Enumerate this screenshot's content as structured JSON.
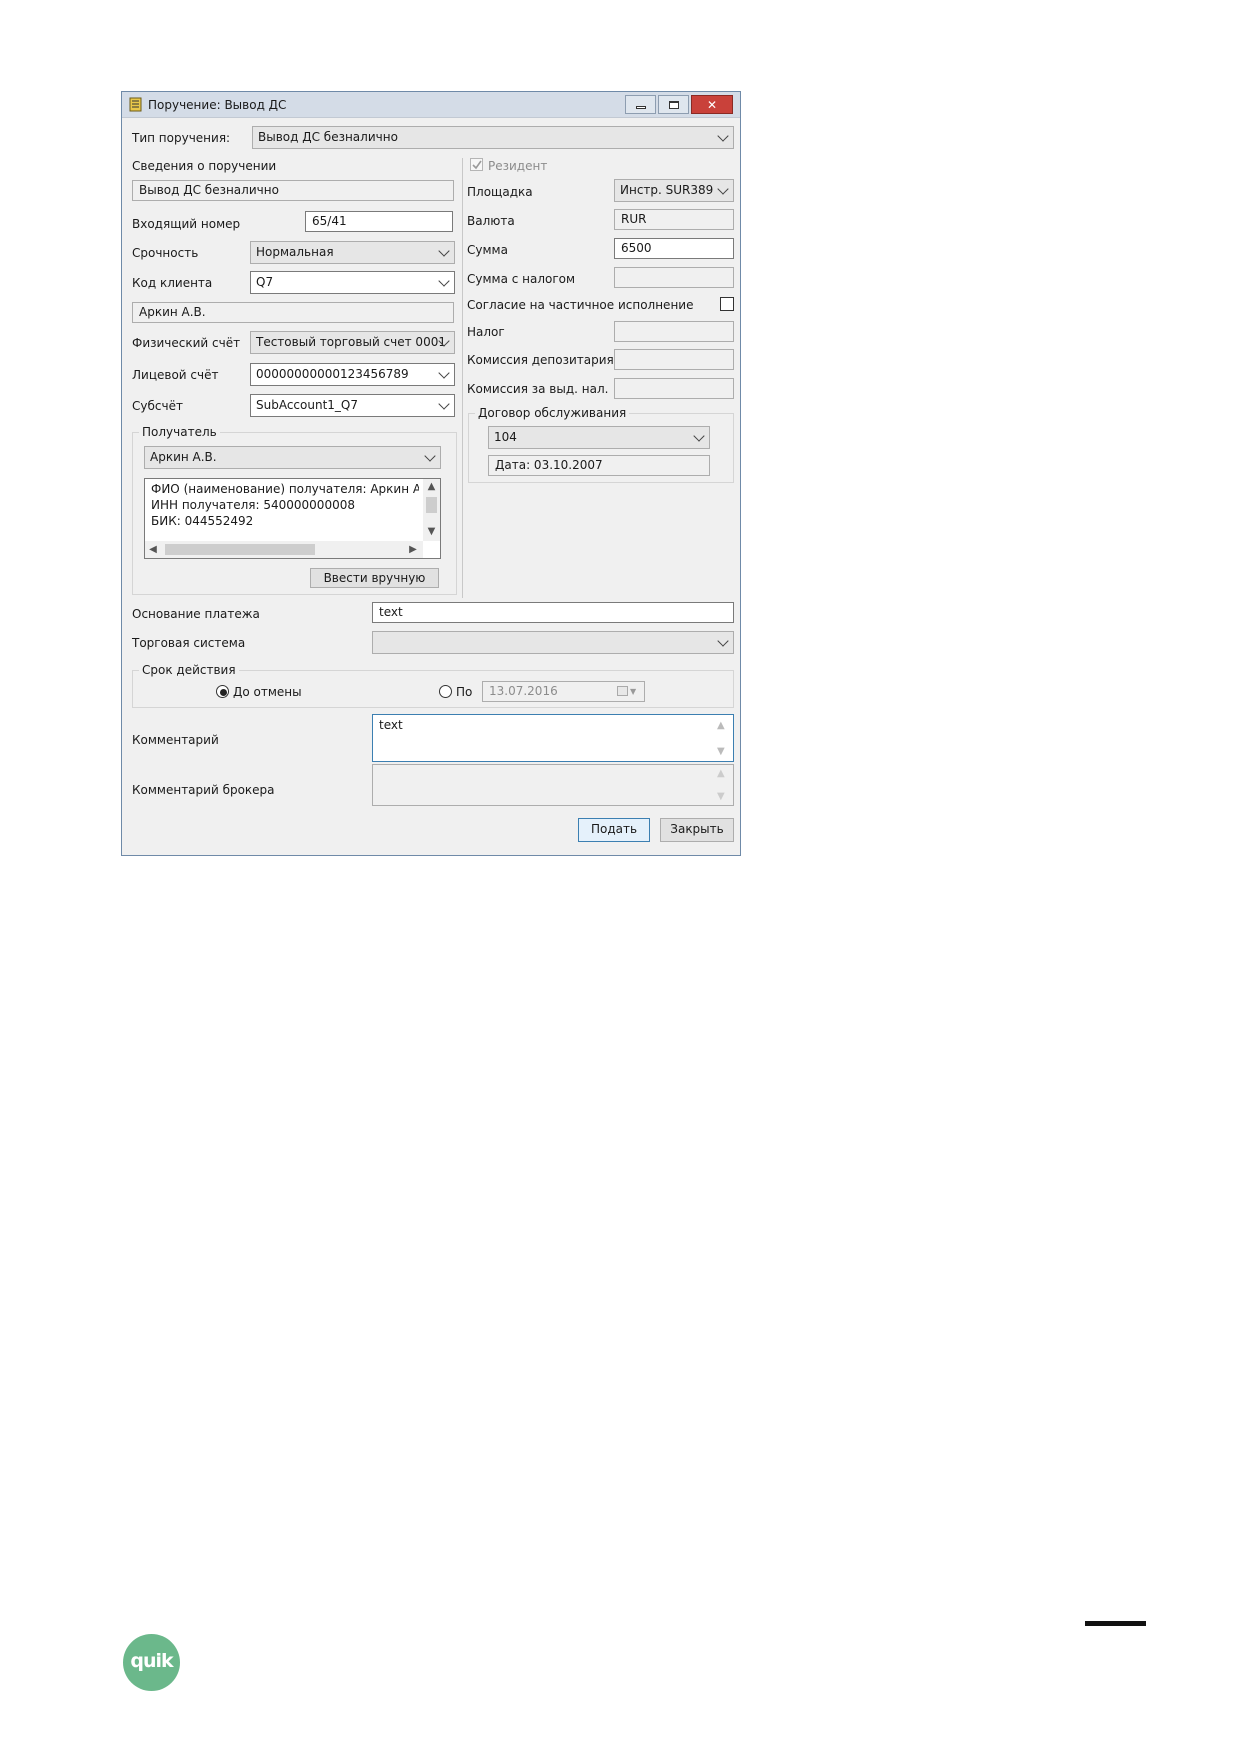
{
  "window": {
    "title": "Поручение: Вывод ДС",
    "minimize_glyph": "▭",
    "maximize_glyph": "▢",
    "close_glyph": "✕"
  },
  "order_type": {
    "label": "Тип поручения:",
    "value": "Вывод ДС безналично"
  },
  "order_info": {
    "label": "Сведения о поручении",
    "value": "Вывод ДС безналично"
  },
  "incoming_number": {
    "label": "Входящий номер",
    "value": "65/41"
  },
  "urgency": {
    "label": "Срочность",
    "value": "Нормальная"
  },
  "client_code": {
    "label": "Код клиента",
    "value": "Q7"
  },
  "client_name": "Аркин А.В.",
  "physical_account": {
    "label": "Физический счёт",
    "value": "Тестовый торговый счет 0001"
  },
  "personal_account": {
    "label": "Лицевой счёт",
    "value": "00000000000123456789"
  },
  "subaccount": {
    "label": "Субсчёт",
    "value": "SubAccount1_Q7"
  },
  "recipient": {
    "legend": "Получатель",
    "selected": "Аркин А.В.",
    "details": [
      "ФИО (наименование) получателя: Аркин Ар",
      "ИНН получателя: 540000000008",
      "БИК: 044552492"
    ],
    "manual_button": "Ввести вручную"
  },
  "resident": {
    "label": "Резидент",
    "checked": true
  },
  "platform": {
    "label": "Площадка",
    "value": "Инстр. SUR389"
  },
  "currency": {
    "label": "Валюта",
    "value": "RUR"
  },
  "amount": {
    "label": "Сумма",
    "value": "6500"
  },
  "amount_with_tax": {
    "label": "Сумма с налогом",
    "value": ""
  },
  "partial_execution": {
    "label": "Согласие на частичное исполнение",
    "checked": false
  },
  "tax": {
    "label": "Налог",
    "value": ""
  },
  "depository_fee": {
    "label": "Комиссия депозитария",
    "value": ""
  },
  "tax_fee": {
    "label": "Комиссия за выд. нал.",
    "value": ""
  },
  "service_contract": {
    "legend": "Договор обслуживания",
    "value": "104",
    "date": "Дата: 03.10.2007"
  },
  "payment_basis": {
    "label": "Основание платежа",
    "value": "text"
  },
  "trading_system": {
    "label": "Торговая система",
    "value": ""
  },
  "validity": {
    "legend": "Срок действия",
    "until_cancel_label": "До отмены",
    "until_date_label": "По",
    "date_value": "13.07.2016",
    "selected": "until_cancel"
  },
  "comment": {
    "label": "Комментарий",
    "value": "text"
  },
  "broker_comment": {
    "label": "Комментарий брокера",
    "value": ""
  },
  "buttons": {
    "submit": "Подать",
    "close": "Закрыть"
  },
  "footer": {
    "logo_text": "quik"
  },
  "colors": {
    "title_bar": "#d4dce7",
    "close_button": "#c9413a",
    "dialog_bg": "#f0f0f0",
    "focus_border": "#3c7fb1",
    "logo": "#6bb88b"
  }
}
